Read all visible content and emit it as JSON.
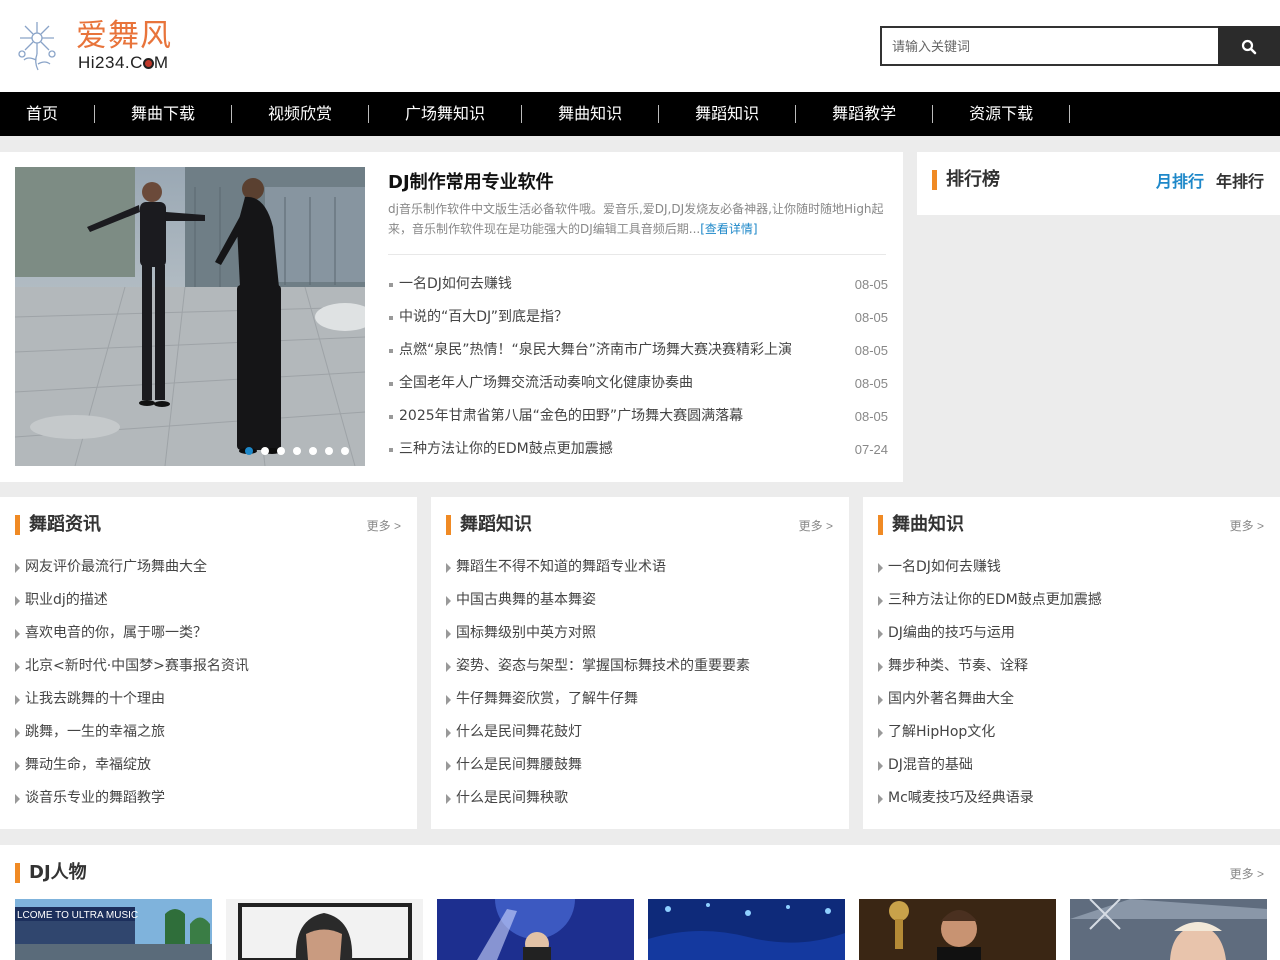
{
  "brand": {
    "name_cn": "爱舞风",
    "name_en_prefix": "Hi234.C",
    "name_en_suffix": "M"
  },
  "search": {
    "placeholder": "请输入关键词",
    "icon": "search-icon"
  },
  "nav": {
    "items": [
      "首页",
      "舞曲下载",
      "视频欣赏",
      "广场舞知识",
      "舞曲知识",
      "舞蹈知识",
      "舞蹈教学",
      "资源下载"
    ]
  },
  "feature": {
    "slider_count": 7,
    "slider_active": 1,
    "title": "DJ制作常用专业软件",
    "desc": "dj音乐制作软件中文版生活必备软件哦。爱音乐,爱DJ,DJ发烧友必备神器,让你随时随地High起来，音乐制作软件现在是功能强大的DJ编辑工具音频后期...",
    "more": "[查看详情]",
    "news": [
      {
        "title": "一名DJ如何去赚钱",
        "date": "08-05"
      },
      {
        "title": "中说的“百大DJ”到底是指？",
        "date": "08-05"
      },
      {
        "title": "点燃“泉民”热情！“泉民大舞台”济南市广场舞大赛决赛精彩上演",
        "date": "08-05"
      },
      {
        "title": "全国老年人广场舞交流活动奏响文化健康协奏曲",
        "date": "08-05"
      },
      {
        "title": "2025年甘肃省第八届“金色的田野”广场舞大赛圆满落幕",
        "date": "08-05"
      },
      {
        "title": "三种方法让你的EDM鼓点更加震撼",
        "date": "07-24"
      }
    ]
  },
  "rank": {
    "title": "排行榜",
    "tab_month": "月排行",
    "tab_year": "年排行"
  },
  "columns": [
    {
      "title": "舞蹈资讯",
      "more": "更多 >",
      "items": [
        "网友评价最流行广场舞曲大全",
        "职业dj的描述",
        "喜欢电音的你，属于哪一类？",
        "北京<新时代·中国梦>赛事报名资讯",
        "让我去跳舞的十个理由",
        "跳舞，一生的幸福之旅",
        "舞动生命，幸福绽放",
        "谈音乐专业的舞蹈教学"
      ]
    },
    {
      "title": "舞蹈知识",
      "more": "更多 >",
      "items": [
        "舞蹈生不得不知道的舞蹈专业术语",
        "中国古典舞的基本舞姿",
        "国标舞级别中英方对照",
        "姿势、姿态与架型：掌握国标舞技术的重要要素",
        "牛仔舞舞姿欣赏，了解牛仔舞",
        "什么是民间舞花鼓灯",
        "什么是民间舞腰鼓舞",
        "什么是民间舞秧歌"
      ]
    },
    {
      "title": "舞曲知识",
      "more": "更多 >",
      "items": [
        "一名DJ如何去赚钱",
        "三种方法让你的EDM鼓点更加震撼",
        "DJ编曲的技巧与运用",
        "舞步种类、节奏、诠释",
        "国内外著名舞曲大全",
        "了解HipHop文化",
        "DJ混音的基础",
        "Mc喊麦技巧及经典语录"
      ]
    }
  ],
  "dj": {
    "title": "DJ人物",
    "more": "更多 >",
    "thumb_banner": "LCOME TO ULTRA MUSIC"
  },
  "colors": {
    "accent_orange": "#f08a24",
    "link_blue": "#1e88c9",
    "nav_bg": "#000000",
    "logo_orange": "#e8743b"
  }
}
